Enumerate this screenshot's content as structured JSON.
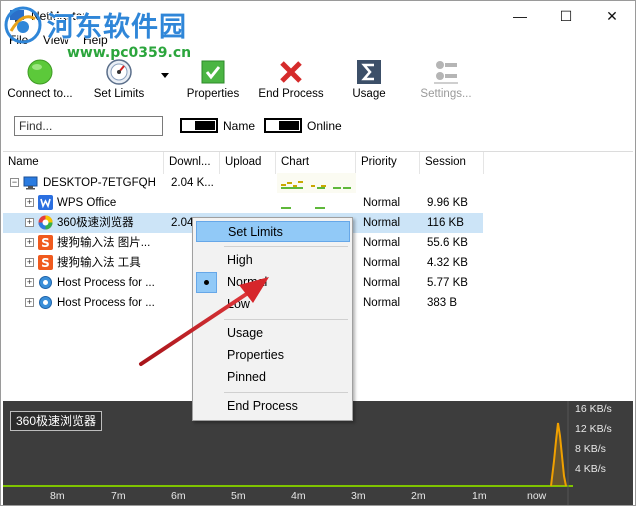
{
  "window": {
    "title": "NetMaster",
    "controls": {
      "minimize": "—",
      "maximize": "☐",
      "close": "✕"
    }
  },
  "watermark": {
    "title": "河东软件园",
    "url": "www.pc0359.cn"
  },
  "menu": {
    "items": [
      "File",
      "View",
      "Help"
    ]
  },
  "toolbar": {
    "connect": "Connect to...",
    "set_limits": "Set Limits",
    "properties": "Properties",
    "end_process": "End Process",
    "usage": "Usage",
    "settings": "Settings..."
  },
  "filter": {
    "find_placeholder": "Find...",
    "name_toggle": "Name",
    "online_toggle": "Online"
  },
  "columns": [
    "Name",
    "Downl...",
    "Upload",
    "Chart",
    "Priority",
    "Session"
  ],
  "rows": [
    {
      "name": "DESKTOP-7ETGFQH",
      "download": "2.04 K...",
      "upload": "",
      "priority": "",
      "session": "",
      "icon": "computer-icon"
    },
    {
      "name": "WPS Office",
      "download": "",
      "upload": "",
      "priority": "Normal",
      "session": "9.96 KB",
      "icon": "wps-icon"
    },
    {
      "name": "360极速浏览器",
      "download": "2.04",
      "upload": "",
      "priority": "Normal",
      "session": "116 KB",
      "icon": "browser-360-icon"
    },
    {
      "name": "搜狗输入法 图片...",
      "download": "",
      "upload": "",
      "priority": "Normal",
      "session": "55.6 KB",
      "icon": "sogou-icon"
    },
    {
      "name": "搜狗输入法 工具",
      "download": "",
      "upload": "",
      "priority": "Normal",
      "session": "4.32 KB",
      "icon": "sogou-icon"
    },
    {
      "name": "Host Process for ...",
      "download": "",
      "upload": "",
      "priority": "Normal",
      "session": "5.77 KB",
      "icon": "gear-icon"
    },
    {
      "name": "Host Process for ...",
      "download": "",
      "upload": "",
      "priority": "Normal",
      "session": "383 B",
      "icon": "gear-icon"
    }
  ],
  "context_menu": {
    "set_limits": "Set Limits",
    "high": "High",
    "normal": "Normal",
    "low": "Low",
    "usage": "Usage",
    "properties": "Properties",
    "pinned": "Pinned",
    "end_process": "End Process",
    "selected_priority": "Normal"
  },
  "graph": {
    "label": "360极速浏览器",
    "y_ticks": [
      "16 KB/s",
      "12 KB/s",
      "8 KB/s",
      "4 KB/s"
    ],
    "x_ticks": [
      "8m",
      "7m",
      "6m",
      "5m",
      "4m",
      "3m",
      "2m",
      "1m",
      "now"
    ]
  },
  "colors": {
    "selection": "#cce4f7",
    "menu_highlight": "#91c9f7",
    "graph_bg": "#3d3d3d",
    "graph_line": "#f0a000",
    "graph_baseline": "#7fc400",
    "arrow": "#d6262b"
  }
}
